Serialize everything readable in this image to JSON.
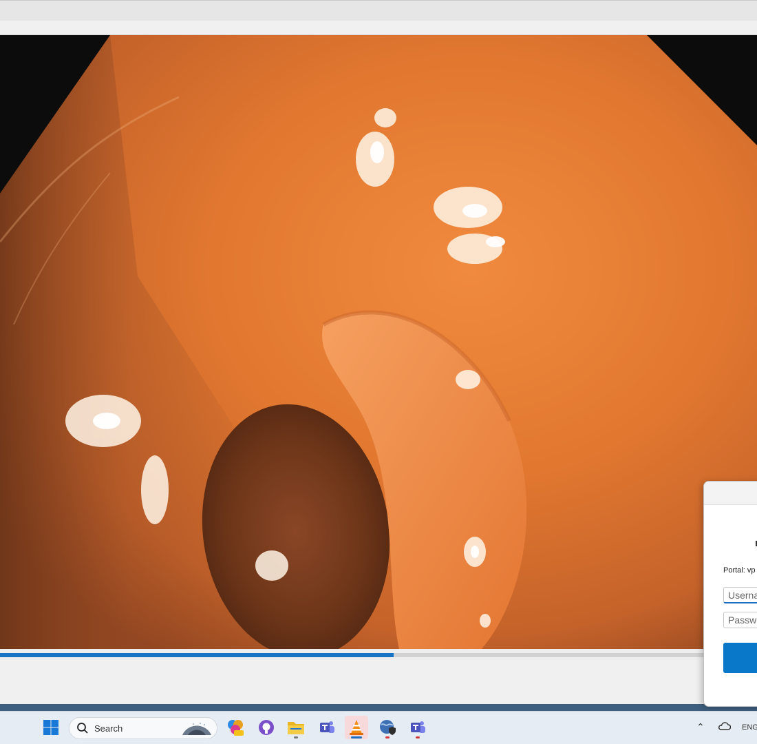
{
  "player": {
    "seek_progress_percent": 52
  },
  "vpn_dialog": {
    "portal_label": "Portal: vp",
    "username_placeholder": "Userna",
    "password_placeholder": "Passwo"
  },
  "taskbar": {
    "search_placeholder": "Search",
    "language": "ENG"
  },
  "colors": {
    "accent": "#1673c6",
    "button": "#0a78c9"
  }
}
